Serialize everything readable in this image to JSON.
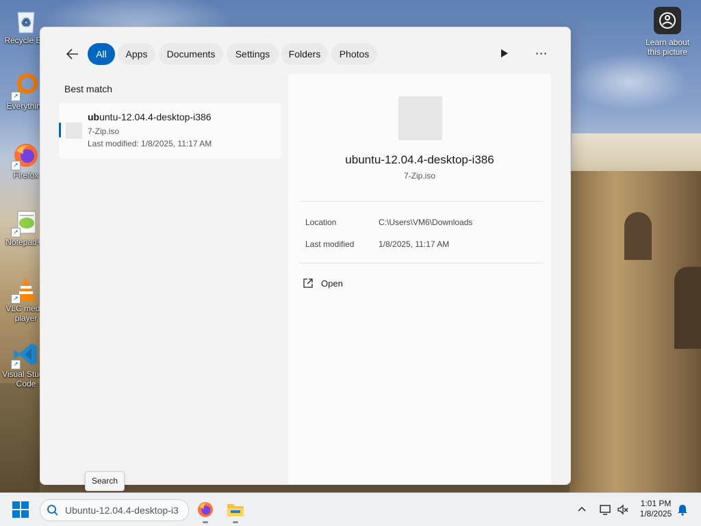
{
  "desktop": {
    "icons": [
      {
        "label": "Recycle Bin",
        "shortcut": false
      },
      {
        "label": "Everything",
        "shortcut": true
      },
      {
        "label": "Firefox",
        "shortcut": true
      },
      {
        "label": "Notepad++",
        "shortcut": true
      },
      {
        "label": "VLC media player",
        "shortcut": true
      },
      {
        "label": "Visual Studio Code",
        "shortcut": true
      }
    ],
    "learn_about": "Learn about this picture"
  },
  "flyout": {
    "tabs": [
      "All",
      "Apps",
      "Documents",
      "Settings",
      "Folders",
      "Photos"
    ],
    "active_tab": "All",
    "best_match_label": "Best match",
    "result": {
      "title_bold": "ub",
      "title_rest": "untu-12.04.4-desktop-i386",
      "subtitle": "7-Zip.iso",
      "modified": "Last modified: 1/8/2025, 11:17 AM"
    },
    "preview": {
      "title": "ubuntu-12.04.4-desktop-i386",
      "subtitle": "7-Zip.iso",
      "location_label": "Location",
      "location_value": "C:\\Users\\VM6\\Downloads",
      "modified_label": "Last modified",
      "modified_value": "1/8/2025, 11:17 AM",
      "open_label": "Open"
    }
  },
  "tooltip": "Search",
  "taskbar": {
    "search_value": "Ubuntu-12.04.4-desktop-i3",
    "time": "1:01 PM",
    "date": "1/8/2025",
    "accent": "#0067c0"
  }
}
